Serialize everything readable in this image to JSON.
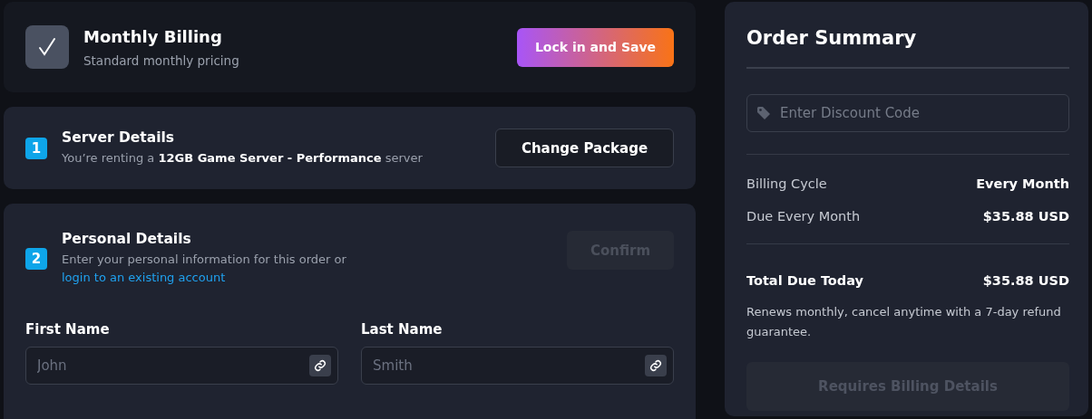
{
  "plan": {
    "checked": true,
    "title": "Monthly Billing",
    "subtitle": "Standard monthly pricing",
    "action": "Lock in and Save"
  },
  "steps": [
    {
      "number": "1",
      "title": "Server Details",
      "description": "You’re renting a **12GB Game Server - Performance** server",
      "button": "Change Package",
      "disabled": false
    },
    {
      "number": "2",
      "title": "Personal Details",
      "description": "Enter your personal information for this order or",
      "link": "login to an existing account",
      "button": "Confirm",
      "disabled": true,
      "fields": [
        {
          "label": "First Name",
          "placeholder": "John"
        },
        {
          "label": "Last Name",
          "placeholder": "Smith"
        }
      ]
    }
  ],
  "summary": {
    "title": "Order Summary",
    "discount": {
      "placeholder": "Enter Discount Code"
    },
    "lines": [
      {
        "label": "Billing Cycle",
        "value": "Every Month"
      },
      {
        "label": "Due Every Month",
        "value": "$35.88 USD"
      }
    ],
    "total": {
      "label": "Total Due Today",
      "value": "$35.88 USD"
    },
    "note": "Renews monthly, cancel anytime with a 7-day refund guarantee.",
    "button": "Requires Billing Details",
    "disabled": true
  }
}
